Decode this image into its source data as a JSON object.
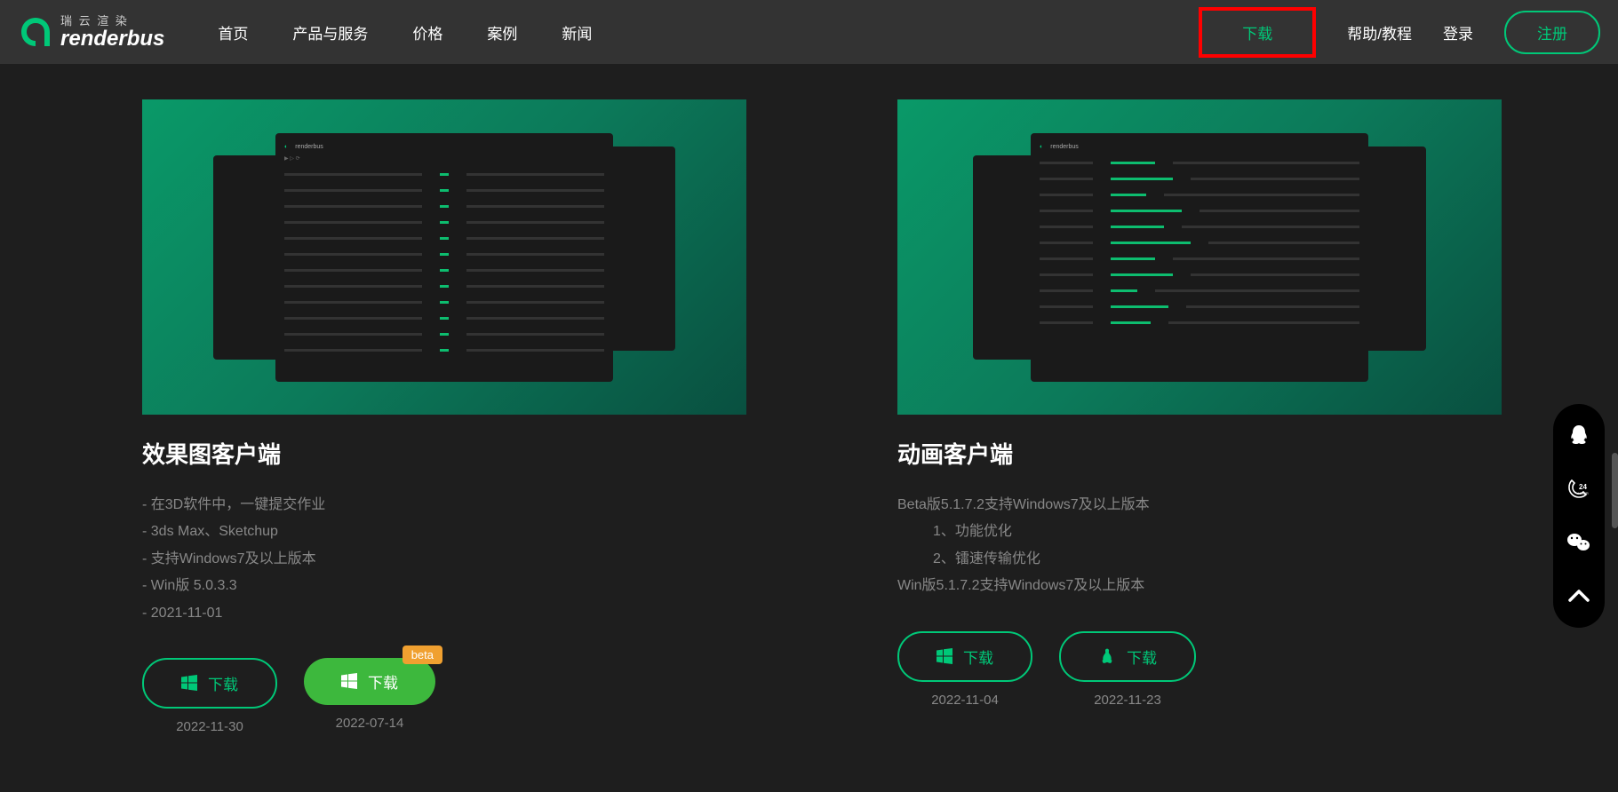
{
  "logo": {
    "cn": "瑞 云 渲 染",
    "en": "renderbus"
  },
  "nav": [
    "首页",
    "产品与服务",
    "价格",
    "案例",
    "新闻"
  ],
  "right": {
    "download": "下载",
    "help": "帮助/教程",
    "login": "登录",
    "signup": "注册"
  },
  "cards": [
    {
      "title": "效果图客户端",
      "features": [
        "- 在3D软件中，一键提交作业",
        "- 3ds Max、Sketchup",
        "- 支持Windows7及以上版本",
        "- Win版 5.0.3.3",
        "- 2021-11-01"
      ],
      "buttons": [
        {
          "label": "下载",
          "os": "windows",
          "style": "outline",
          "date": "2022-11-30",
          "beta": ""
        },
        {
          "label": "下载",
          "os": "windows",
          "style": "solid",
          "date": "2022-07-14",
          "beta": "beta"
        }
      ]
    },
    {
      "title": "动画客户端",
      "features": [
        "Beta版5.1.7.2支持Windows7及以上版本",
        "1、功能优化",
        "2、镭速传输优化",
        "Win版5.1.7.2支持Windows7及以上版本"
      ],
      "buttons": [
        {
          "label": "下载",
          "os": "windows",
          "style": "outline",
          "date": "2022-11-04",
          "beta": ""
        },
        {
          "label": "下载",
          "os": "linux",
          "style": "outline",
          "date": "2022-11-23",
          "beta": ""
        }
      ]
    }
  ]
}
